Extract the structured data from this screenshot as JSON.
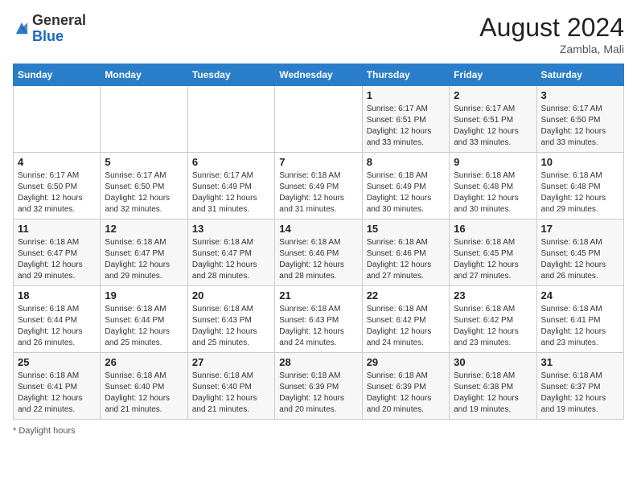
{
  "header": {
    "logo_general": "General",
    "logo_blue": "Blue",
    "month_title": "August 2024",
    "subtitle": "Zambla, Mali"
  },
  "days_of_week": [
    "Sunday",
    "Monday",
    "Tuesday",
    "Wednesday",
    "Thursday",
    "Friday",
    "Saturday"
  ],
  "footer": {
    "note": "Daylight hours"
  },
  "weeks": [
    [
      {
        "day": "",
        "info": ""
      },
      {
        "day": "",
        "info": ""
      },
      {
        "day": "",
        "info": ""
      },
      {
        "day": "",
        "info": ""
      },
      {
        "day": "1",
        "info": "Sunrise: 6:17 AM\nSunset: 6:51 PM\nDaylight: 12 hours\nand 33 minutes."
      },
      {
        "day": "2",
        "info": "Sunrise: 6:17 AM\nSunset: 6:51 PM\nDaylight: 12 hours\nand 33 minutes."
      },
      {
        "day": "3",
        "info": "Sunrise: 6:17 AM\nSunset: 6:50 PM\nDaylight: 12 hours\nand 33 minutes."
      }
    ],
    [
      {
        "day": "4",
        "info": "Sunrise: 6:17 AM\nSunset: 6:50 PM\nDaylight: 12 hours\nand 32 minutes."
      },
      {
        "day": "5",
        "info": "Sunrise: 6:17 AM\nSunset: 6:50 PM\nDaylight: 12 hours\nand 32 minutes."
      },
      {
        "day": "6",
        "info": "Sunrise: 6:17 AM\nSunset: 6:49 PM\nDaylight: 12 hours\nand 31 minutes."
      },
      {
        "day": "7",
        "info": "Sunrise: 6:18 AM\nSunset: 6:49 PM\nDaylight: 12 hours\nand 31 minutes."
      },
      {
        "day": "8",
        "info": "Sunrise: 6:18 AM\nSunset: 6:49 PM\nDaylight: 12 hours\nand 30 minutes."
      },
      {
        "day": "9",
        "info": "Sunrise: 6:18 AM\nSunset: 6:48 PM\nDaylight: 12 hours\nand 30 minutes."
      },
      {
        "day": "10",
        "info": "Sunrise: 6:18 AM\nSunset: 6:48 PM\nDaylight: 12 hours\nand 29 minutes."
      }
    ],
    [
      {
        "day": "11",
        "info": "Sunrise: 6:18 AM\nSunset: 6:47 PM\nDaylight: 12 hours\nand 29 minutes."
      },
      {
        "day": "12",
        "info": "Sunrise: 6:18 AM\nSunset: 6:47 PM\nDaylight: 12 hours\nand 29 minutes."
      },
      {
        "day": "13",
        "info": "Sunrise: 6:18 AM\nSunset: 6:47 PM\nDaylight: 12 hours\nand 28 minutes."
      },
      {
        "day": "14",
        "info": "Sunrise: 6:18 AM\nSunset: 6:46 PM\nDaylight: 12 hours\nand 28 minutes."
      },
      {
        "day": "15",
        "info": "Sunrise: 6:18 AM\nSunset: 6:46 PM\nDaylight: 12 hours\nand 27 minutes."
      },
      {
        "day": "16",
        "info": "Sunrise: 6:18 AM\nSunset: 6:45 PM\nDaylight: 12 hours\nand 27 minutes."
      },
      {
        "day": "17",
        "info": "Sunrise: 6:18 AM\nSunset: 6:45 PM\nDaylight: 12 hours\nand 26 minutes."
      }
    ],
    [
      {
        "day": "18",
        "info": "Sunrise: 6:18 AM\nSunset: 6:44 PM\nDaylight: 12 hours\nand 26 minutes."
      },
      {
        "day": "19",
        "info": "Sunrise: 6:18 AM\nSunset: 6:44 PM\nDaylight: 12 hours\nand 25 minutes."
      },
      {
        "day": "20",
        "info": "Sunrise: 6:18 AM\nSunset: 6:43 PM\nDaylight: 12 hours\nand 25 minutes."
      },
      {
        "day": "21",
        "info": "Sunrise: 6:18 AM\nSunset: 6:43 PM\nDaylight: 12 hours\nand 24 minutes."
      },
      {
        "day": "22",
        "info": "Sunrise: 6:18 AM\nSunset: 6:42 PM\nDaylight: 12 hours\nand 24 minutes."
      },
      {
        "day": "23",
        "info": "Sunrise: 6:18 AM\nSunset: 6:42 PM\nDaylight: 12 hours\nand 23 minutes."
      },
      {
        "day": "24",
        "info": "Sunrise: 6:18 AM\nSunset: 6:41 PM\nDaylight: 12 hours\nand 23 minutes."
      }
    ],
    [
      {
        "day": "25",
        "info": "Sunrise: 6:18 AM\nSunset: 6:41 PM\nDaylight: 12 hours\nand 22 minutes."
      },
      {
        "day": "26",
        "info": "Sunrise: 6:18 AM\nSunset: 6:40 PM\nDaylight: 12 hours\nand 21 minutes."
      },
      {
        "day": "27",
        "info": "Sunrise: 6:18 AM\nSunset: 6:40 PM\nDaylight: 12 hours\nand 21 minutes."
      },
      {
        "day": "28",
        "info": "Sunrise: 6:18 AM\nSunset: 6:39 PM\nDaylight: 12 hours\nand 20 minutes."
      },
      {
        "day": "29",
        "info": "Sunrise: 6:18 AM\nSunset: 6:39 PM\nDaylight: 12 hours\nand 20 minutes."
      },
      {
        "day": "30",
        "info": "Sunrise: 6:18 AM\nSunset: 6:38 PM\nDaylight: 12 hours\nand 19 minutes."
      },
      {
        "day": "31",
        "info": "Sunrise: 6:18 AM\nSunset: 6:37 PM\nDaylight: 12 hours\nand 19 minutes."
      }
    ]
  ]
}
